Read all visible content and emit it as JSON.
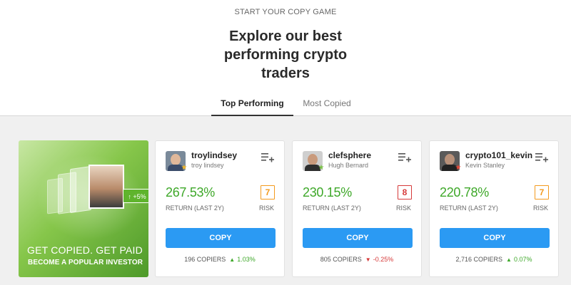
{
  "header": {
    "eyebrow": "START YOUR COPY GAME",
    "headline": "Explore our best performing crypto traders"
  },
  "tabs": [
    {
      "label": "Top Performing",
      "active": true
    },
    {
      "label": "Most Copied",
      "active": false
    }
  ],
  "promo": {
    "badge": "+5%",
    "line1": "GET COPIED. GET PAID",
    "line2": "BECOME A POPULAR INVESTOR"
  },
  "labels": {
    "return": "RETURN (LAST 2Y)",
    "risk": "RISK",
    "copy": "COPY",
    "copiers": "COPIERS"
  },
  "colors": {
    "positive": "#3ea829",
    "negative": "#d63a3a",
    "copy_button": "#2b9af3",
    "risk_medium": "#f39a1e",
    "risk_high": "#d63a3a"
  },
  "traders": [
    {
      "username": "troylindsey",
      "real_name": "troy lindsey",
      "badge_icon": "star-icon",
      "return": "267.53%",
      "risk": "7",
      "risk_color": "#f39a1e",
      "copiers": "196 COPIERS",
      "change": "1.03%",
      "change_direction": "up"
    },
    {
      "username": "clefsphere",
      "real_name": "Hugh Bernard",
      "badge_icon": "star-icon",
      "return": "230.15%",
      "risk": "8",
      "risk_color": "#d63a3a",
      "copiers": "805 COPIERS",
      "change": "-0.25%",
      "change_direction": "down"
    },
    {
      "username": "crypto101_kevin",
      "real_name": "Kevin Stanley",
      "badge_icon": "star-icon",
      "return": "220.78%",
      "risk": "7",
      "risk_color": "#f39a1e",
      "copiers": "2,716 COPIERS",
      "change": "0.07%",
      "change_direction": "up"
    }
  ]
}
